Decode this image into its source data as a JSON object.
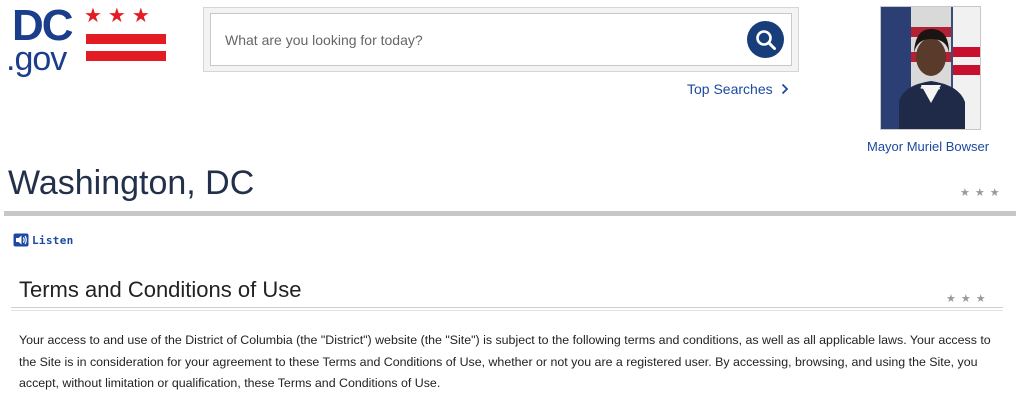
{
  "header": {
    "logo": {
      "dc_text": "DC",
      "gov_text": ".gov",
      "stars": "★★★",
      "brand_red": "#e31b23",
      "brand_blue": "#1b3e8c"
    },
    "search": {
      "placeholder": "What are you looking for today?",
      "value": "",
      "button_icon": "search-icon"
    },
    "top_searches_label": "Top Searches",
    "top_searches_icon": "chevron-right-icon",
    "mayor": {
      "name": "Mayor Muriel Bowser",
      "photo": "mayor-photo"
    }
  },
  "page": {
    "title": "Washington, DC",
    "title_stars": "★★★",
    "listen_label": "Listen",
    "listen_icon": "speaker-icon"
  },
  "section": {
    "title": "Terms and Conditions of Use",
    "stars": "★★★",
    "paragraph": "Your access to and use of the District of Columbia (the \"District\") website (the \"Site\") is subject to the following terms and conditions, as well as all applicable laws. Your access to the Site is in consideration for your agreement to these Terms and Conditions of Use, whether or not you are a registered user. By accessing, browsing, and using the Site, you accept, without limitation or qualification, these Terms and Conditions of Use."
  },
  "colors": {
    "link": "#1b4aa0",
    "search_button": "#173d7a",
    "rule": "#c7c7c7",
    "stars_gray": "#999999"
  }
}
